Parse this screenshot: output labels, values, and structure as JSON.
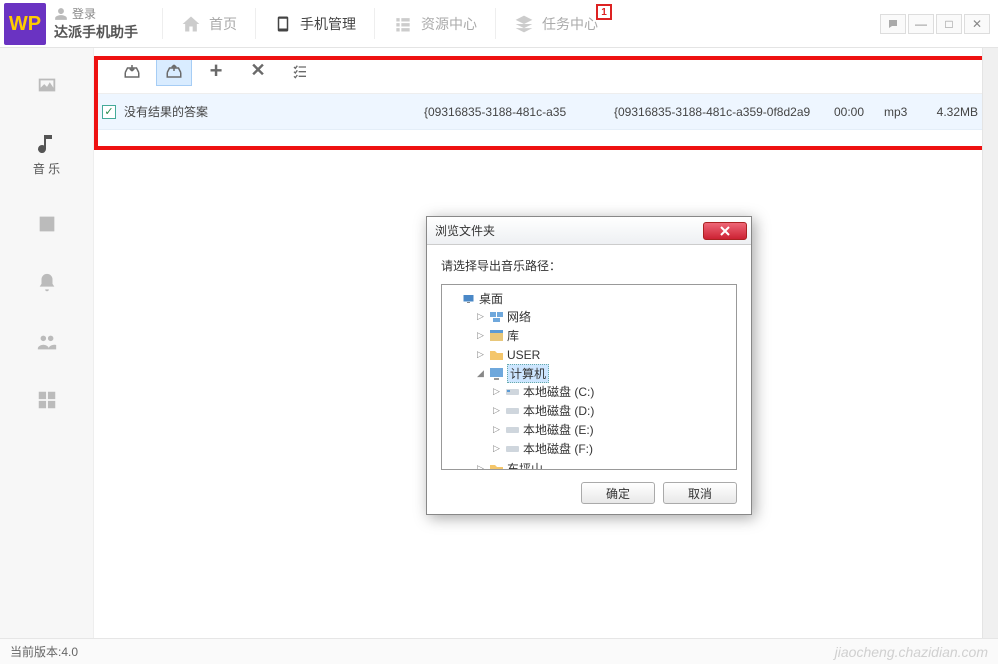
{
  "brand": {
    "login": "登录",
    "name": "达派手机助手",
    "logo_text": "WP"
  },
  "nav": {
    "home": "首页",
    "phone": "手机管理",
    "resource": "资源中心",
    "tasks": "任务中心",
    "badge": "1"
  },
  "sidebar": {
    "music_label": "音 乐"
  },
  "row": {
    "title": "没有结果的答案",
    "col2": "{09316835-3188-481c-a35",
    "col3": "{09316835-3188-481c-a359-0f8d2a9",
    "duration": "00:00",
    "format": "mp3",
    "size": "4.32MB"
  },
  "dialog": {
    "title": "浏览文件夹",
    "prompt": "请选择导出音乐路径：",
    "ok": "确定",
    "cancel": "取消",
    "tree": {
      "desktop": "桌面",
      "network": "网络",
      "library": "库",
      "user": "USER",
      "computer": "计算机",
      "disk_c": "本地磁盘 (C:)",
      "disk_d": "本地磁盘 (D:)",
      "disk_e": "本地磁盘 (E:)",
      "disk_f": "本地磁盘 (F:)",
      "dps": "东坪山"
    }
  },
  "status": {
    "version_label": "当前版本:4.0",
    "watermark": "jiaocheng.chazidian.com"
  }
}
